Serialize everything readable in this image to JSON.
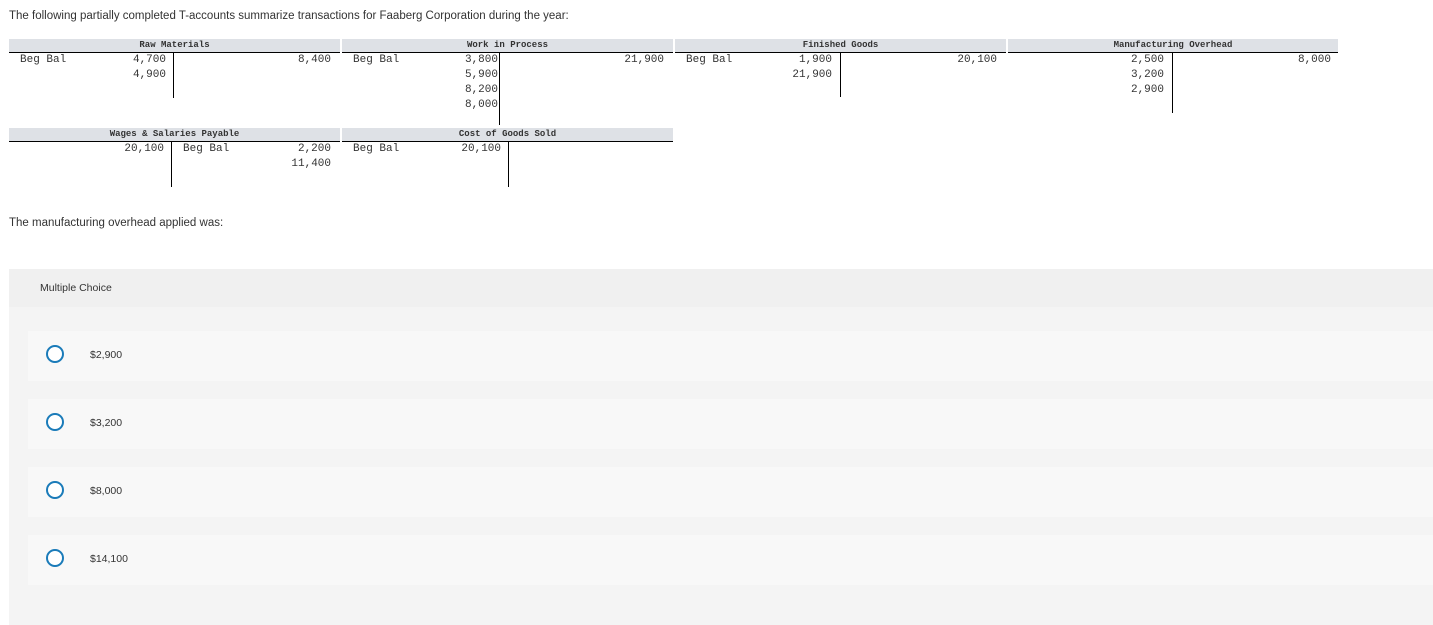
{
  "question": {
    "intro": "The following partially completed T-accounts summarize transactions for Faaberg Corporation during the year:",
    "prompt": "The manufacturing overhead applied was:"
  },
  "taccounts": {
    "raw_materials": {
      "title": "Raw Materials",
      "beg_label": "Beg Bal",
      "debits": "4,700\n4,900",
      "credits": "8,400"
    },
    "wip": {
      "title": "Work in Process",
      "beg_label": "Beg Bal",
      "debits": "3,800\n5,900\n8,200\n8,000",
      "credits": "21,900"
    },
    "finished_goods": {
      "title": "Finished Goods",
      "beg_label": "Beg Bal",
      "debits": "1,900\n21,900",
      "credits": "20,100"
    },
    "mfg_overhead": {
      "title": "Manufacturing Overhead",
      "debits": "2,500\n3,200\n2,900",
      "credits": "8,000"
    },
    "wages_payable": {
      "title": "Wages & Salaries Payable",
      "debits": "20,100",
      "beg_label": "Beg Bal",
      "credits": "2,200\n11,400"
    },
    "cogs": {
      "title": "Cost of Goods Sold",
      "beg_label": "Beg Bal",
      "debits": "20,100"
    }
  },
  "multiple_choice": {
    "title": "Multiple Choice",
    "options": [
      {
        "label": "$2,900"
      },
      {
        "label": "$3,200"
      },
      {
        "label": "$8,000"
      },
      {
        "label": "$14,100"
      }
    ]
  }
}
